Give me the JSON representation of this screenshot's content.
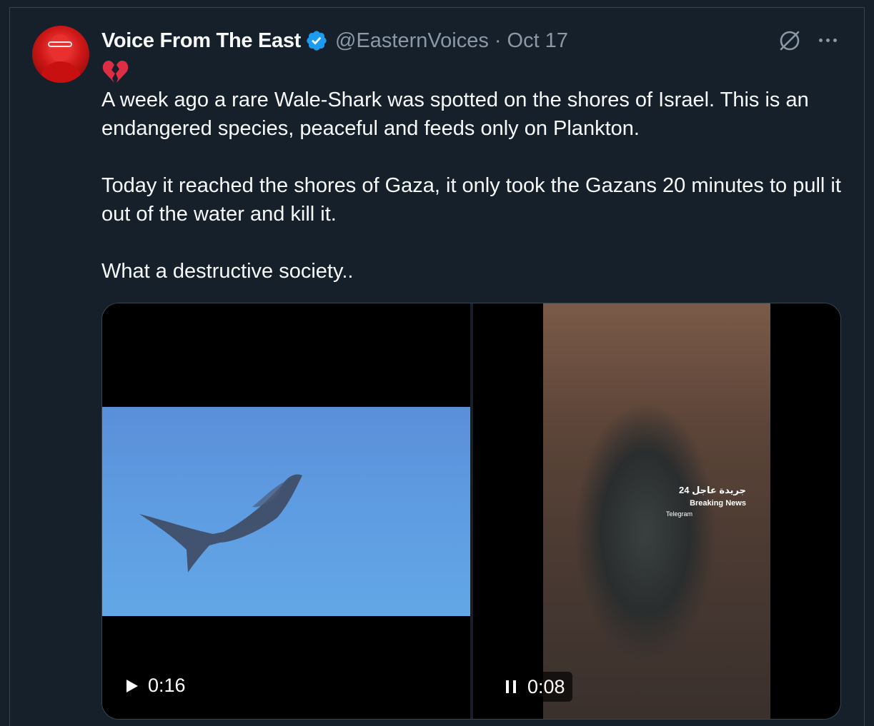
{
  "tweet": {
    "display_name": "Voice From The East",
    "handle": "@EasternVoices",
    "separator": "·",
    "date": "Oct 17",
    "emoji": "💔",
    "paragraphs": [
      "A week ago a rare Wale-Shark was spotted on the shores of Israel. This is an endangered species, peaceful and feeds only on Plankton.",
      "Today it reached the shores of Gaza, it only took the Gazans 20 minutes to pull it out of the water and kill it.",
      "What a destructive society.."
    ]
  },
  "media": {
    "videos": [
      {
        "time": "0:16",
        "state": "paused",
        "control_icon": "play-icon"
      },
      {
        "time": "0:08",
        "state": "playing",
        "control_icon": "pause-icon",
        "overlay_arabic": "جريدة عاجل 24",
        "overlay_english": "Breaking News",
        "overlay_telegram": "Telegram"
      }
    ]
  },
  "colors": {
    "background": "#15202b",
    "text": "#f7f9f9",
    "muted": "#8b98a5",
    "verified": "#1d9bf0",
    "border": "#38444d"
  },
  "icons": {
    "verified": "verified-badge-icon",
    "grok": "grok-icon",
    "more": "more-icon"
  }
}
